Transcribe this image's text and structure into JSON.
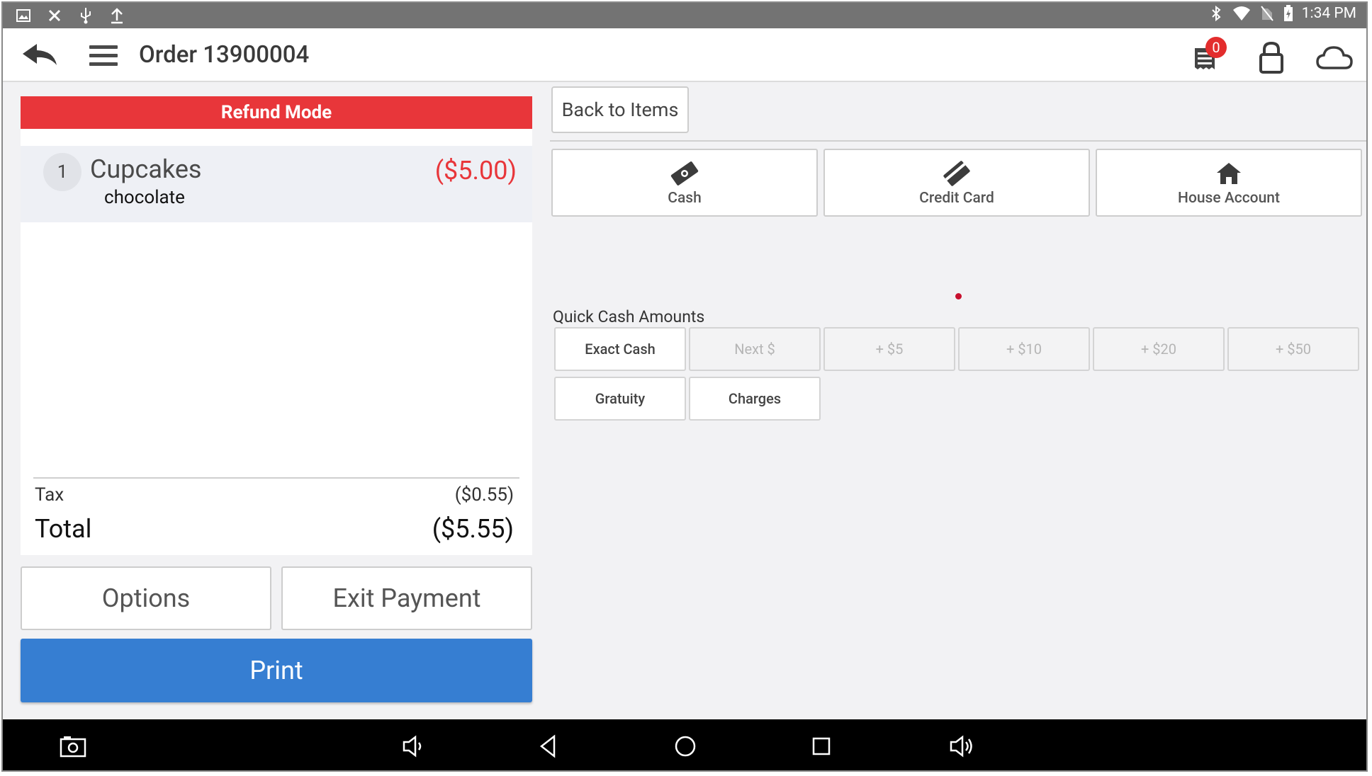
{
  "status_bar": {
    "time": "1:34 PM",
    "left_icons": [
      "image-icon",
      "crossed-tools-icon",
      "usb-icon",
      "upload-icon"
    ],
    "right_icons": [
      "bluetooth-icon",
      "wifi-icon",
      "no-sim-icon",
      "battery-charging-icon"
    ]
  },
  "app_bar": {
    "title": "Order 13900004",
    "notification_count": "0",
    "icons": [
      "back-arrow-icon",
      "hamburger-menu-icon",
      "receipt-icon",
      "lock-icon",
      "cloud-icon"
    ]
  },
  "order": {
    "mode_banner": "Refund Mode",
    "items": [
      {
        "qty": "1",
        "name": "Cupcakes",
        "modifier": "chocolate",
        "price": "($5.00)"
      }
    ],
    "tax_label": "Tax",
    "tax_value": "($0.55)",
    "total_label": "Total",
    "total_value": "($5.55)"
  },
  "actions": {
    "options_label": "Options",
    "exit_payment_label": "Exit Payment",
    "print_label": "Print"
  },
  "payment": {
    "back_to_items_label": "Back to Items",
    "tenders": [
      {
        "label": "Cash",
        "icon": "cash-icon"
      },
      {
        "label": "Credit Card",
        "icon": "credit-card-icon"
      },
      {
        "label": "House Account",
        "icon": "house-icon"
      }
    ],
    "quick_cash_title": "Quick Cash Amounts",
    "quick_cash": [
      {
        "label": "Exact Cash",
        "enabled": true
      },
      {
        "label": "Next $",
        "enabled": false
      },
      {
        "label": "+ $5",
        "enabled": false
      },
      {
        "label": "+ $10",
        "enabled": false
      },
      {
        "label": "+ $20",
        "enabled": false
      },
      {
        "label": "+ $50",
        "enabled": false
      },
      {
        "label": "Gratuity",
        "enabled": true
      },
      {
        "label": "Charges",
        "enabled": true
      }
    ]
  },
  "colors": {
    "refund_red": "#e8363a",
    "print_blue": "#367ed2",
    "status_bar": "#737373",
    "badge_red": "#e32d2d"
  },
  "nav_bar": {
    "icons": [
      "screenshot-icon",
      "volume-down-icon",
      "nav-back-icon",
      "nav-home-icon",
      "nav-recents-icon",
      "volume-up-icon"
    ]
  }
}
